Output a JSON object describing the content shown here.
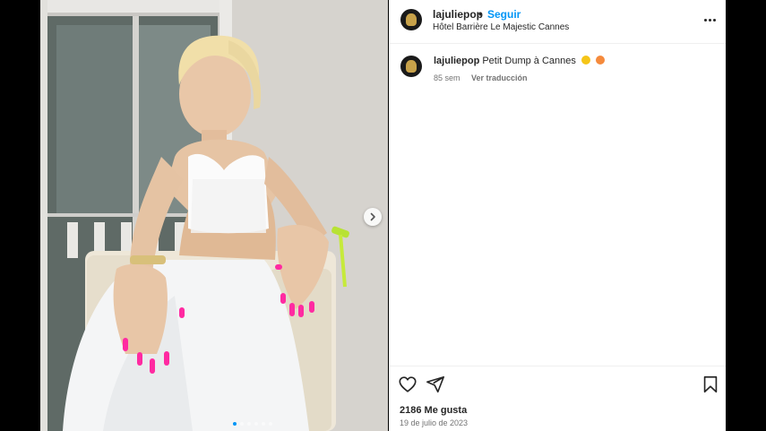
{
  "post": {
    "username": "lajuliepop",
    "separator": "•",
    "follow_label": "Seguir",
    "location": "Hôtel Barrière Le Majestic Cannes",
    "caption": "Petit Dump à Cannes",
    "caption_emojis": [
      "sun-emoji",
      "flushed-face-emoji"
    ],
    "age": "85 sem",
    "translate_label": "Ver traducción",
    "likes": "2186 Me gusta",
    "date": "19 de julio de 2023"
  },
  "carousel": {
    "total_slides": 6,
    "active_slide": 1,
    "next_icon": "chevron-right-icon"
  },
  "colors": {
    "accent": "#0095f6",
    "text": "#262626",
    "secondary_text": "#737373",
    "nail_polish": "#ff2aa1"
  },
  "icons": [
    "heart-icon",
    "share-icon",
    "bookmark-icon",
    "more-options-icon"
  ]
}
